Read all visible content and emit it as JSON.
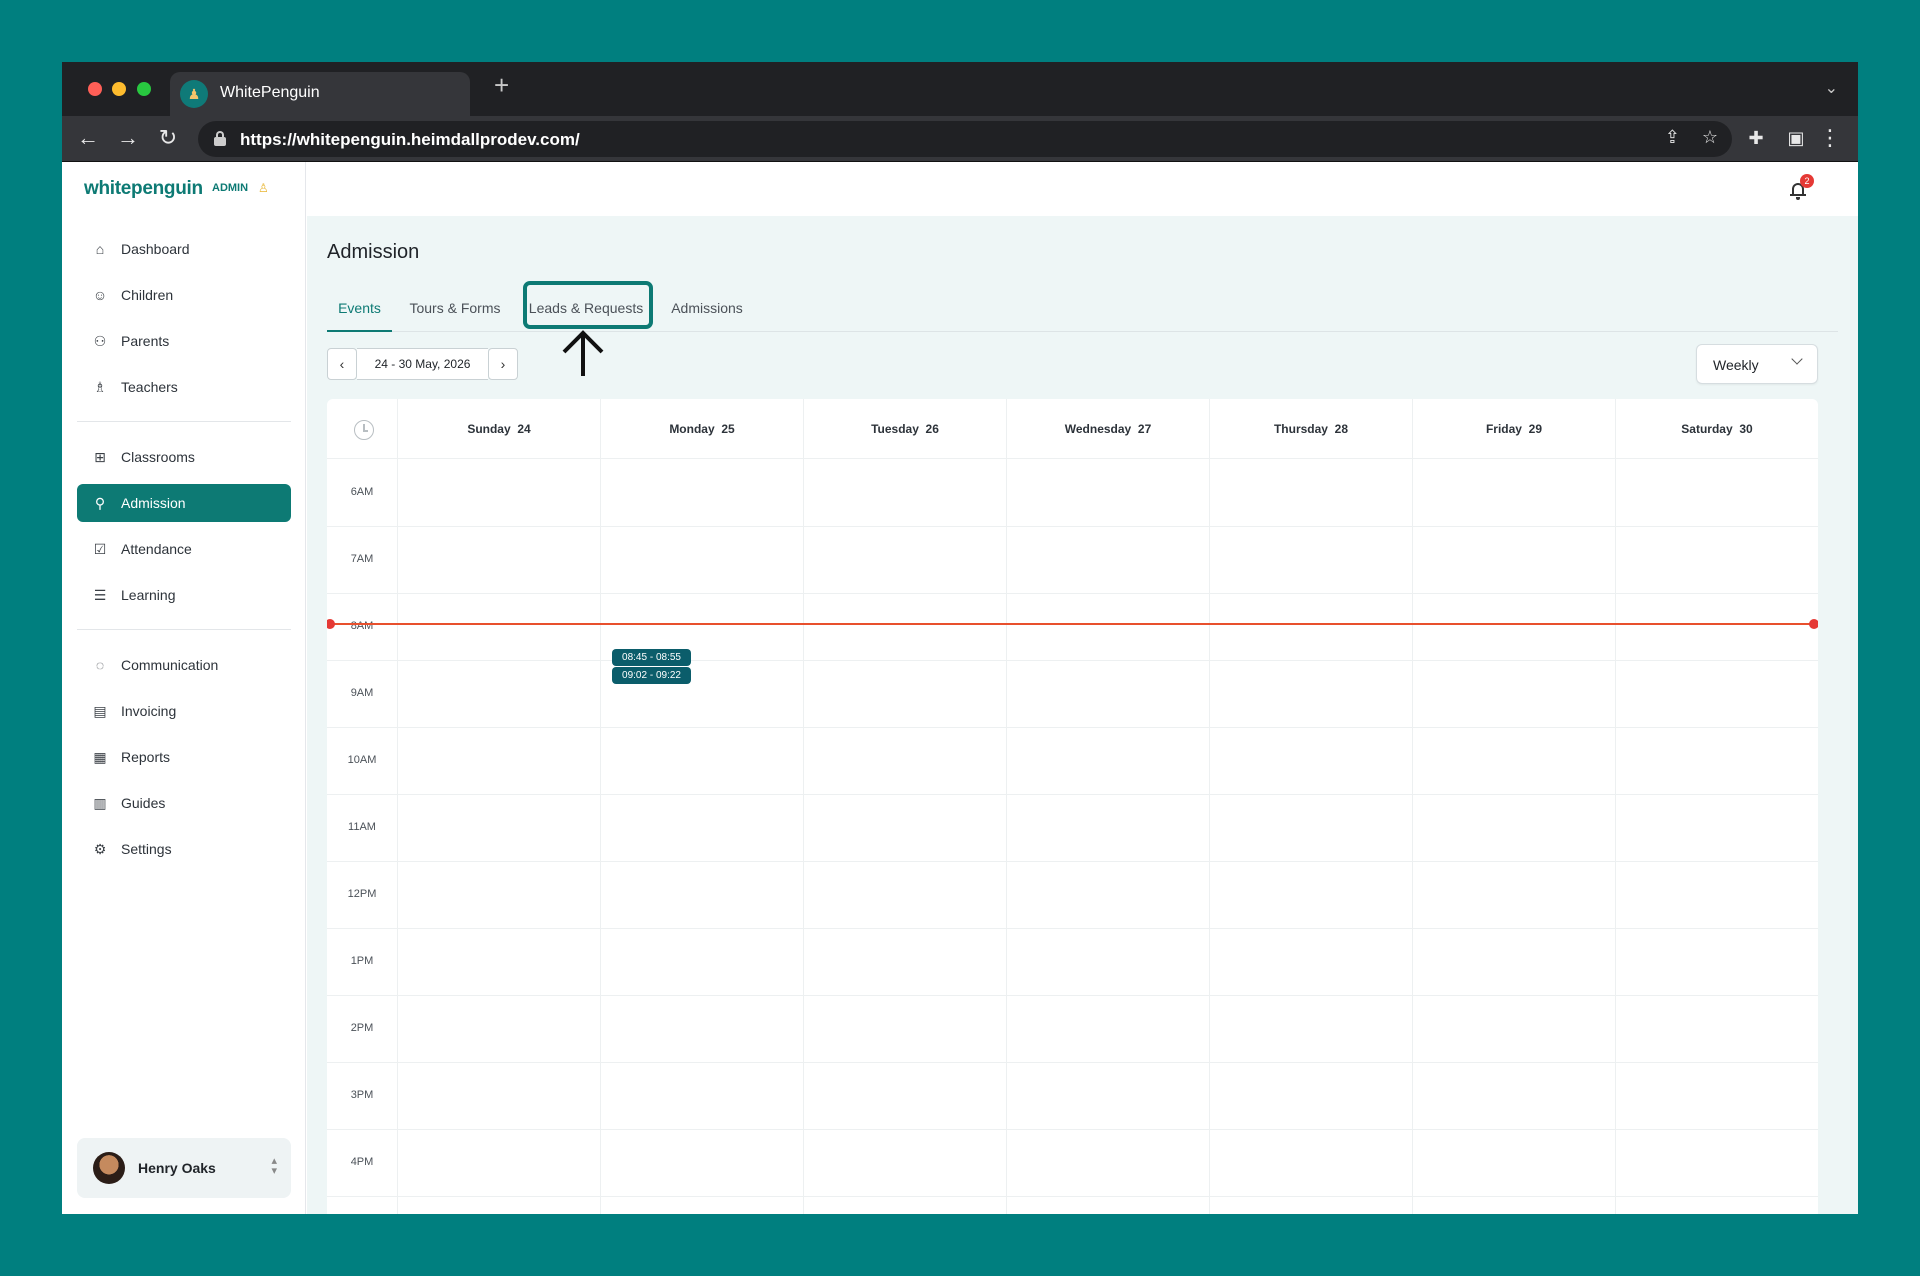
{
  "browser": {
    "tab_title": "WhitePenguin",
    "new_tab_symbol": "+",
    "url": "https://whitepenguin.heimdallprodev.com/"
  },
  "brand": {
    "name": "whitepenguin",
    "role": "ADMIN",
    "accent": "#0d7a74"
  },
  "sidebar": {
    "items": [
      {
        "label": "Dashboard",
        "icon": "home-icon"
      },
      {
        "label": "Children",
        "icon": "child-icon"
      },
      {
        "label": "Parents",
        "icon": "parents-icon"
      },
      {
        "label": "Teachers",
        "icon": "teacher-icon"
      },
      {
        "label": "Classrooms",
        "icon": "grid-icon"
      },
      {
        "label": "Admission",
        "icon": "user-add-icon",
        "active": true
      },
      {
        "label": "Attendance",
        "icon": "check-square-icon"
      },
      {
        "label": "Learning",
        "icon": "book-icon"
      },
      {
        "label": "Communication",
        "icon": "chat-icon"
      },
      {
        "label": "Invoicing",
        "icon": "invoice-icon"
      },
      {
        "label": "Reports",
        "icon": "chart-icon"
      },
      {
        "label": "Guides",
        "icon": "guide-icon"
      },
      {
        "label": "Settings",
        "icon": "gear-icon"
      }
    ]
  },
  "user": {
    "name": "Henry Oaks"
  },
  "notifications": {
    "count": "2"
  },
  "page": {
    "title": "Admission",
    "tabs": [
      {
        "label": "Events",
        "active": true
      },
      {
        "label": "Tours & Forms"
      },
      {
        "label": "Leads & Requests",
        "highlighted": true
      },
      {
        "label": "Admissions"
      }
    ]
  },
  "calendar": {
    "range": "24 - 30 May, 2026",
    "view": "Weekly",
    "days": [
      {
        "name": "Sunday",
        "date": "24"
      },
      {
        "name": "Monday",
        "date": "25"
      },
      {
        "name": "Tuesday",
        "date": "26"
      },
      {
        "name": "Wednesday",
        "date": "27"
      },
      {
        "name": "Thursday",
        "date": "28"
      },
      {
        "name": "Friday",
        "date": "29"
      },
      {
        "name": "Saturday",
        "date": "30"
      }
    ],
    "hours": [
      "6AM",
      "7AM",
      "8AM",
      "9AM",
      "10AM",
      "11AM",
      "12PM",
      "1PM",
      "2PM",
      "3PM",
      "4PM"
    ],
    "events": [
      {
        "label": "08:45 - 08:55",
        "day": "Monday"
      },
      {
        "label": "09:02 - 09:22",
        "day": "Monday"
      }
    ],
    "now_line_color": "#e8502d",
    "event_color": "#0b5d6b"
  }
}
